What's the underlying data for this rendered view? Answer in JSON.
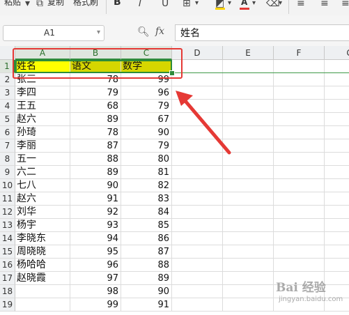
{
  "toolbar": {
    "paste": "粘贴",
    "copy": "复制",
    "format_painter": "格式刷",
    "bold": "B",
    "font_color_letter": "A",
    "font_color": "#e53935",
    "fill_color": "#ffd400"
  },
  "formula_bar": {
    "cell_ref": "A1",
    "fx": "fx",
    "content": "姓名"
  },
  "columns": [
    "A",
    "B",
    "C",
    "D",
    "E",
    "F",
    "G"
  ],
  "rows": [
    {
      "n": "1",
      "name": "姓名",
      "b": "语文",
      "c": "数学"
    },
    {
      "n": "2",
      "name": "张三",
      "b": "78",
      "c": "99"
    },
    {
      "n": "3",
      "name": "李四",
      "b": "79",
      "c": "96"
    },
    {
      "n": "4",
      "name": "王五",
      "b": "68",
      "c": "79"
    },
    {
      "n": "5",
      "name": "赵六",
      "b": "89",
      "c": "67"
    },
    {
      "n": "6",
      "name": "孙琦",
      "b": "78",
      "c": "90"
    },
    {
      "n": "7",
      "name": "李丽",
      "b": "87",
      "c": "79"
    },
    {
      "n": "8",
      "name": "五一",
      "b": "88",
      "c": "80"
    },
    {
      "n": "9",
      "name": "六二",
      "b": "89",
      "c": "81"
    },
    {
      "n": "10",
      "name": "七八",
      "b": "90",
      "c": "82"
    },
    {
      "n": "11",
      "name": "赵六",
      "b": "91",
      "c": "83"
    },
    {
      "n": "12",
      "name": "刘华",
      "b": "92",
      "c": "84"
    },
    {
      "n": "13",
      "name": "杨宇",
      "b": "93",
      "c": "85"
    },
    {
      "n": "14",
      "name": "李晓东",
      "b": "94",
      "c": "86"
    },
    {
      "n": "15",
      "name": "周晓晓",
      "b": "95",
      "c": "87"
    },
    {
      "n": "16",
      "name": "杨哈哈",
      "b": "96",
      "c": "88"
    },
    {
      "n": "17",
      "name": "赵晓霞",
      "b": "97",
      "c": "89"
    },
    {
      "n": "18",
      "name": "",
      "b": "98",
      "c": "90"
    },
    {
      "n": "19",
      "name": "",
      "b": "99",
      "c": "91"
    }
  ],
  "colors": {
    "selection": "#2e8b3a",
    "highlight_yellow": "#ffff00",
    "highlight_olive": "#d6d600",
    "annotation_red": "#e53935"
  },
  "watermark": {
    "main": "Bai 经验",
    "sub": "jingyan.baidu.com"
  }
}
